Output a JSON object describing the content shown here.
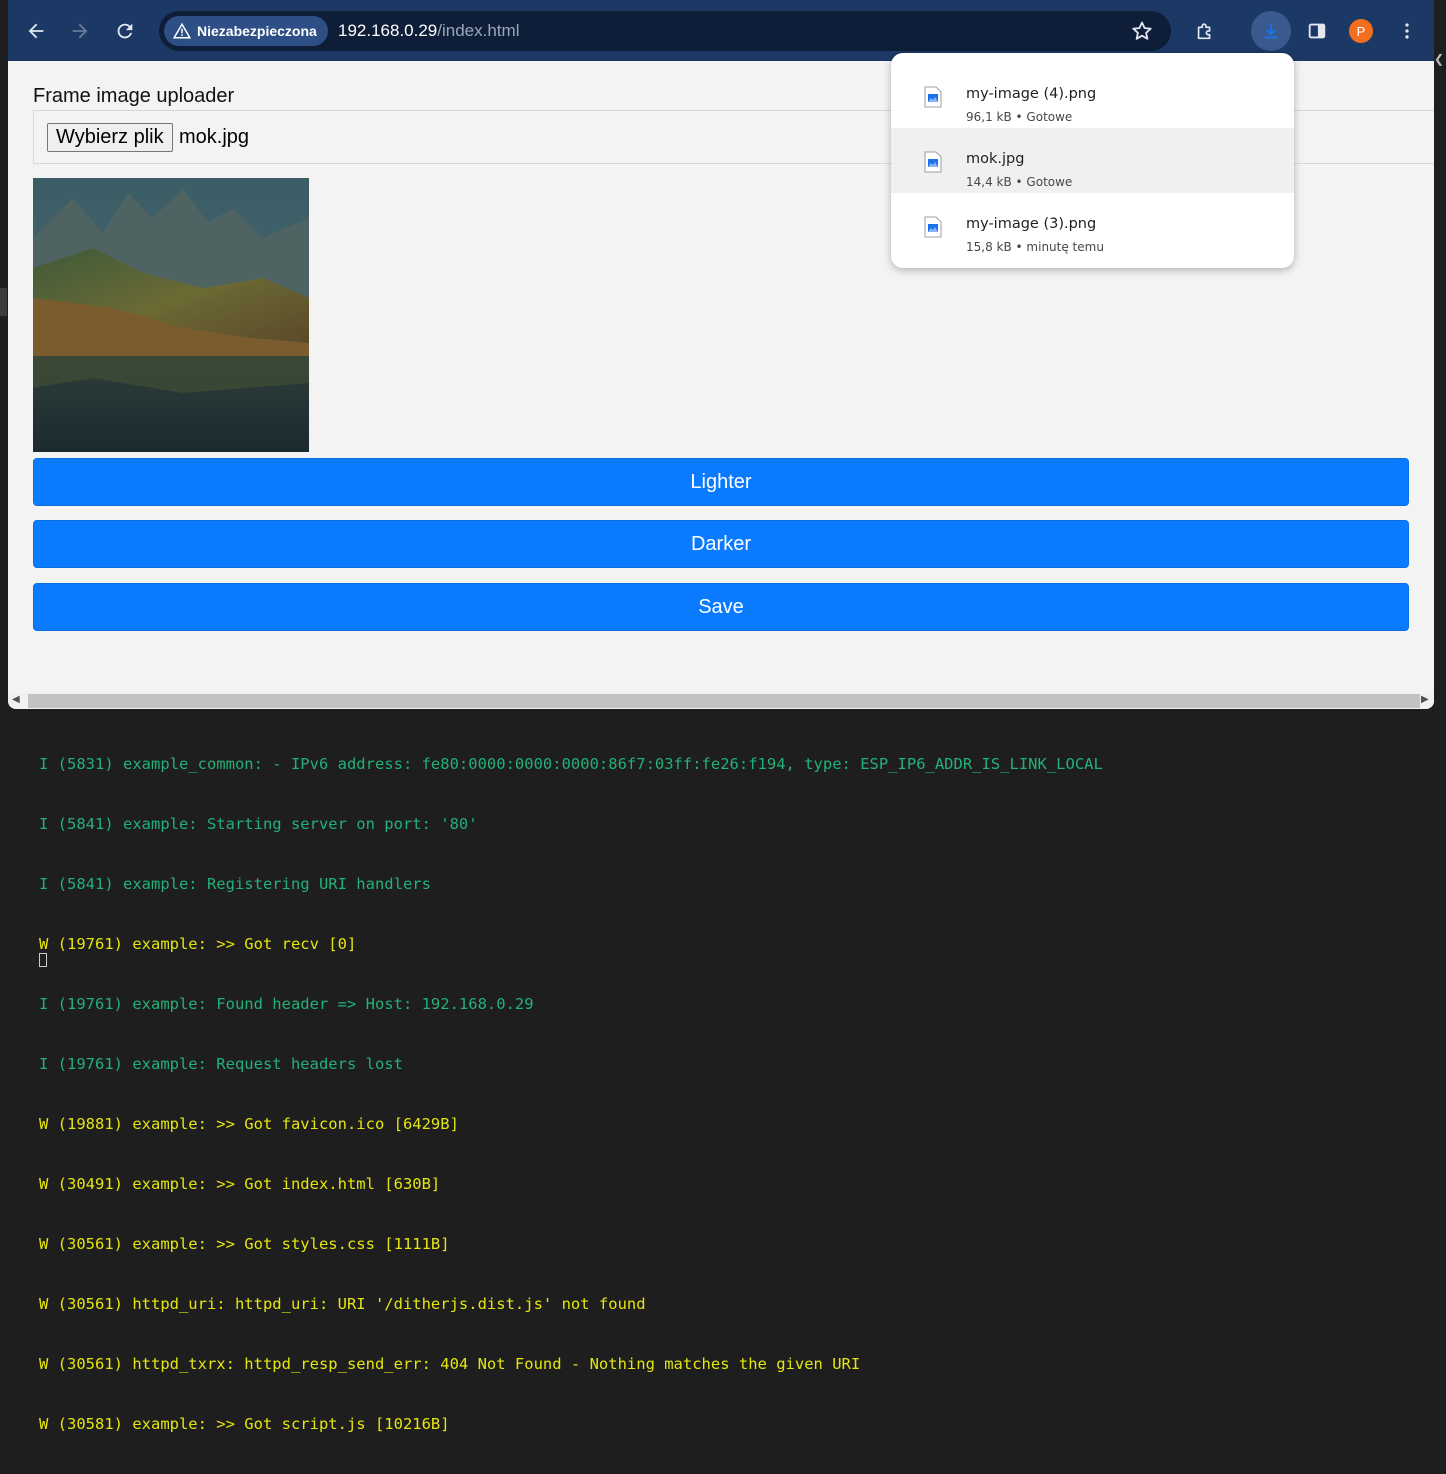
{
  "browser": {
    "security_label": "Niezabezpieczona",
    "url_host": "192.168.0.29",
    "url_path": "/index.html",
    "avatar_letter": "P",
    "toolbar_color": "#1c3965",
    "icons": [
      "back-arrow-icon",
      "forward-arrow-icon",
      "reload-icon",
      "warning-triangle-icon",
      "bookmark-star-icon",
      "extensions-puzzle-icon",
      "download-icon",
      "side-panel-icon",
      "kebab-menu-icon"
    ]
  },
  "page": {
    "uploader_label": "Frame image uploader",
    "choose_file_label": "Wybierz plik",
    "file_name": "mok.jpg",
    "buttons": {
      "lighter": "Lighter",
      "darker": "Darker",
      "save": "Save"
    },
    "button_color": "#0a7bff"
  },
  "downloads": [
    {
      "name": "my-image (4).png",
      "meta": "96,1 kB • Gotowe"
    },
    {
      "name": "mok.jpg",
      "meta": "14,4 kB • Gotowe"
    },
    {
      "name": "my-image (3).png",
      "meta": "15,8 kB • minutę temu"
    }
  ],
  "terminal": {
    "lines": [
      {
        "level": "I",
        "text": "I (5831) example_common: - IPv6 address: fe80:0000:0000:0000:86f7:03ff:fe26:f194, type: ESP_IP6_ADDR_IS_LINK_LOCAL"
      },
      {
        "level": "I",
        "text": "I (5841) example: Starting server on port: '80'"
      },
      {
        "level": "I",
        "text": "I (5841) example: Registering URI handlers"
      },
      {
        "level": "W",
        "text": "W (19761) example: >> Got recv [0]"
      },
      {
        "level": "I",
        "text": "I (19761) example: Found header => Host: 192.168.0.29"
      },
      {
        "level": "I",
        "text": "I (19761) example: Request headers lost"
      },
      {
        "level": "W",
        "text": "W (19881) example: >> Got favicon.ico [6429B]"
      },
      {
        "level": "W",
        "text": "W (30491) example: >> Got index.html [630B]"
      },
      {
        "level": "W",
        "text": "W (30561) example: >> Got styles.css [1111B]"
      },
      {
        "level": "W",
        "text": "W (30561) httpd_uri: httpd_uri: URI '/ditherjs.dist.js' not found"
      },
      {
        "level": "W",
        "text": "W (30561) httpd_txrx: httpd_resp_send_err: 404 Not Found - Nothing matches the given URI"
      },
      {
        "level": "W",
        "text": "W (30581) example: >> Got script.js [10216B]"
      }
    ],
    "info_color": "#23b07a",
    "warn_color": "#e5e510"
  }
}
